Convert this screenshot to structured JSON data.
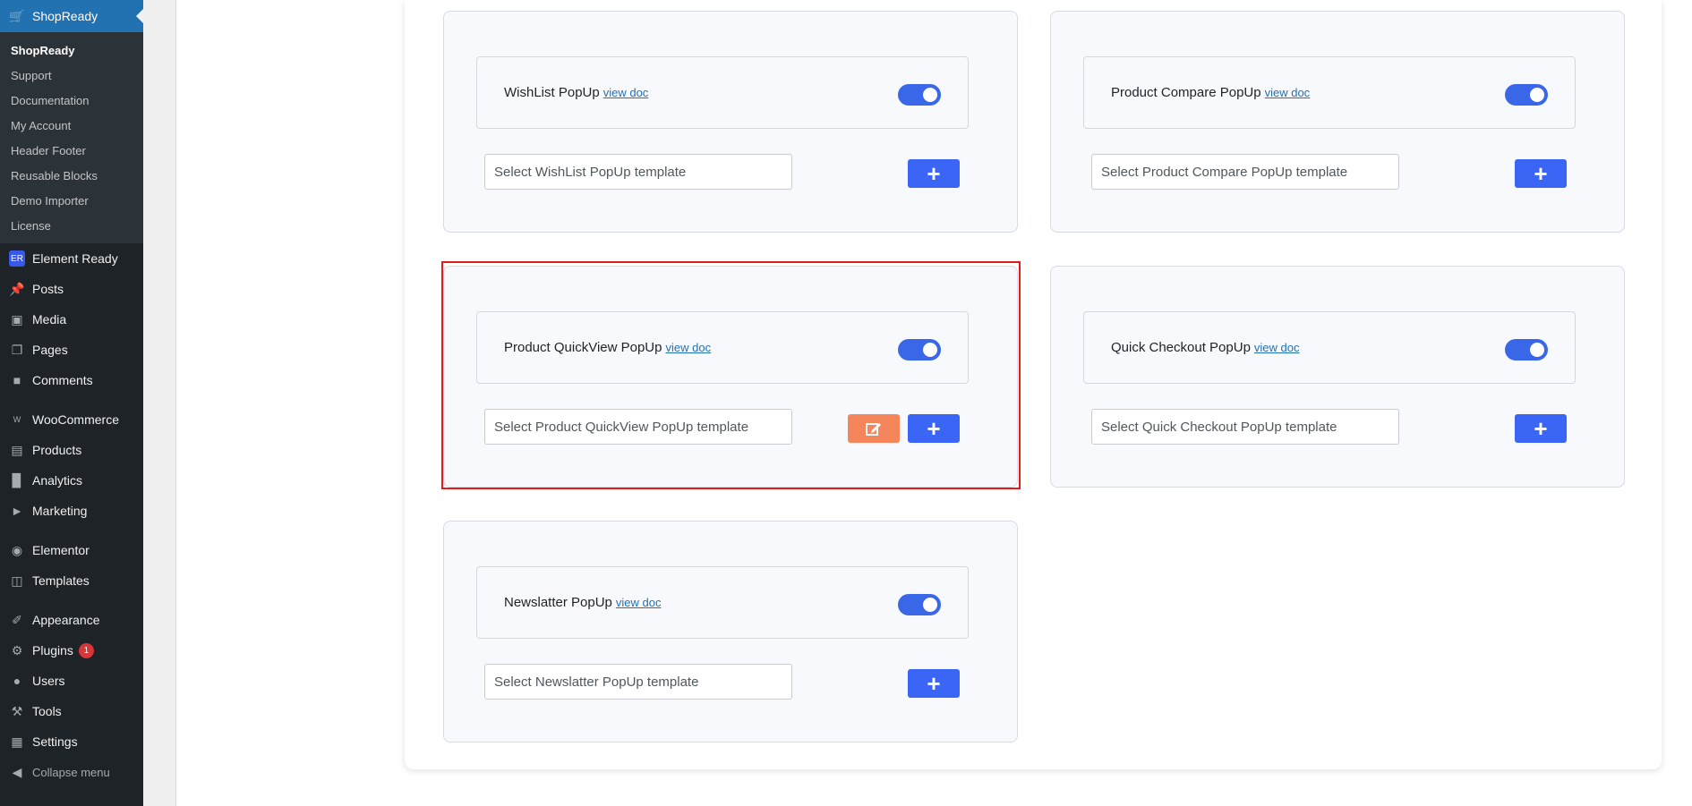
{
  "sidebar": {
    "active": "ShopReady",
    "submenu": [
      "ShopReady",
      "Support",
      "Documentation",
      "My Account",
      "Header Footer",
      "Reusable Blocks",
      "Demo Importer",
      "License"
    ],
    "items": [
      {
        "label": "Element Ready",
        "icon": "element-ready-icon"
      },
      {
        "label": "Posts",
        "icon": "pin-icon"
      },
      {
        "label": "Media",
        "icon": "media-icon"
      },
      {
        "label": "Pages",
        "icon": "pages-icon"
      },
      {
        "label": "Comments",
        "icon": "comment-icon"
      },
      {
        "label": "WooCommerce",
        "icon": "woo-icon"
      },
      {
        "label": "Products",
        "icon": "archive-icon"
      },
      {
        "label": "Analytics",
        "icon": "bar-chart-icon"
      },
      {
        "label": "Marketing",
        "icon": "megaphone-icon"
      },
      {
        "label": "Elementor",
        "icon": "elementor-icon"
      },
      {
        "label": "Templates",
        "icon": "folder-icon"
      },
      {
        "label": "Appearance",
        "icon": "brush-icon"
      },
      {
        "label": "Plugins",
        "icon": "plugin-icon",
        "badge": "1"
      },
      {
        "label": "Users",
        "icon": "user-icon"
      },
      {
        "label": "Tools",
        "icon": "wrench-icon"
      },
      {
        "label": "Settings",
        "icon": "settings-icon"
      }
    ],
    "collapse": "Collapse menu"
  },
  "cards": [
    {
      "title": "WishList PopUp",
      "doc": "view doc",
      "placeholder": "Select WishList PopUp template",
      "enabled": true
    },
    {
      "title": "Product Compare PopUp",
      "doc": "view doc",
      "placeholder": "Select Product Compare PopUp template",
      "enabled": true
    },
    {
      "title": "Product QuickView PopUp",
      "doc": "view doc",
      "placeholder": "Select Product QuickView PopUp template",
      "enabled": true
    },
    {
      "title": "Quick Checkout PopUp",
      "doc": "view doc",
      "placeholder": "Select Quick Checkout PopUp template",
      "enabled": true
    },
    {
      "title": "Newslatter PopUp",
      "doc": "view doc",
      "placeholder": "Select Newslatter PopUp template",
      "enabled": true
    }
  ],
  "colors": {
    "toggle": "#3a66e8",
    "plus": "#3b66f5",
    "edit": "#f5855a",
    "highlight": "#e31b1b"
  }
}
